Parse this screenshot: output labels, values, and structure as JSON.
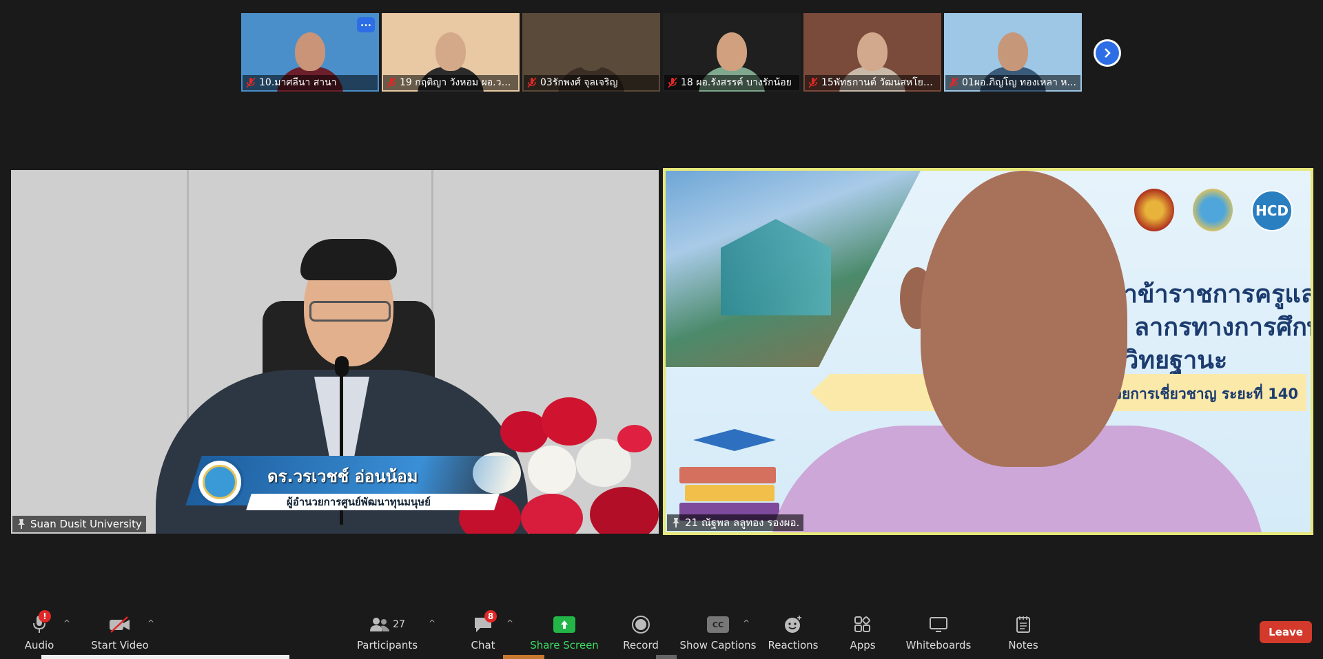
{
  "thumbnails": [
    {
      "name": "10.มาศลีนา  สานา",
      "muted": true,
      "scene": "#4a8fca",
      "skin": "#c99478",
      "cloth": "#6b1f2a",
      "has_more": true
    },
    {
      "name": "19 กฤติญา วังหอม ผอ.วอ...",
      "muted": true,
      "scene": "#e8c9a3",
      "skin": "#d4a98a",
      "cloth": "#2b2b2b",
      "has_more": false
    },
    {
      "name": "03รักพงศ์ จุลเจริญ",
      "muted": true,
      "scene": "#5a4a3a",
      "skin": "#5a4a3a",
      "cloth": "#3a2e25",
      "has_more": false
    },
    {
      "name": "18 ผอ.รังสรรค์ บางรักน้อย",
      "muted": true,
      "scene": "#1f1f1f",
      "skin": "#d1a17f",
      "cloth": "#7fa88f",
      "has_more": false
    },
    {
      "name": "15พัทธกานต์  วัฒนสหโยธิ...",
      "muted": true,
      "scene": "#7a4a3a",
      "skin": "#d2a98c",
      "cloth": "#c9b9a9",
      "has_more": false
    },
    {
      "name": "01ผอ.ภิญโญ  ทองเหลา ห...",
      "muted": true,
      "scene": "#9ec7e6",
      "skin": "#c7977a",
      "cloth": "#3a5a7a",
      "has_more": false
    }
  ],
  "more_button": "...",
  "tiles": {
    "left": {
      "label": "Suan Dusit University",
      "lower_third_name": "ดร.วรเวชช์ อ่อนน้อม",
      "lower_third_title": "ผู้อำนวยการศูนย์พัฒนาทุนมนุษย์"
    },
    "right": {
      "label": "21 ณัฐพล ลลูทอง รองผอ.",
      "slide_line1": "นาข้าราชการครูและ",
      "slide_line2": "ลากรทางการศึกษา",
      "slide_line3": "ก         ละเลื่อนเป็นวิทยฐานะ",
      "slide_banner": "หลักสูตรวิทยฐานะ            ผู้อำนวยการเชี่ยวชาญ ระยะที่ 140",
      "hcd_logo": "HCD"
    }
  },
  "toolbar": {
    "audio": "Audio",
    "audio_badge": "!",
    "start_video": "Start Video",
    "participants": "Participants",
    "participants_count": "27",
    "chat": "Chat",
    "chat_badge": "8",
    "share_screen": "Share Screen",
    "record": "Record",
    "show_captions": "Show Captions",
    "cc": "CC",
    "reactions": "Reactions",
    "apps": "Apps",
    "whiteboards": "Whiteboards",
    "notes": "Notes",
    "leave": "Leave",
    "caret": "^"
  },
  "colors": {
    "active_speaker_border": "#e6e87a",
    "accent_blue": "#2d6ee6",
    "share_green": "#23b548",
    "leave_red": "#d33a2c"
  }
}
